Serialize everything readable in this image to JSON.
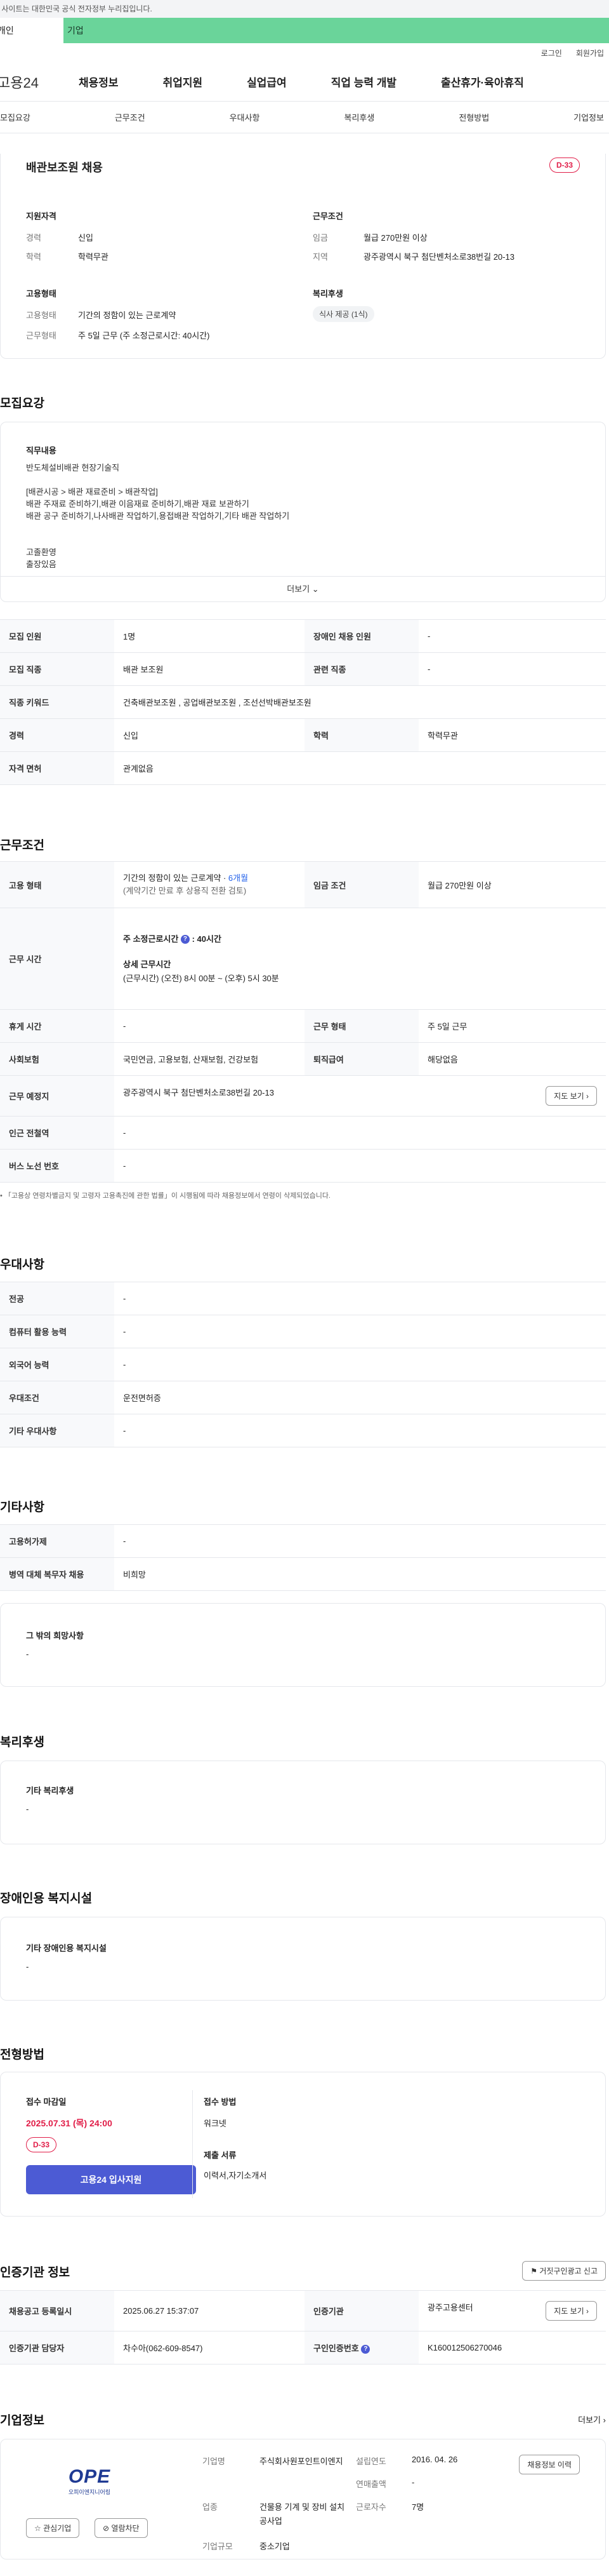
{
  "gov_banner": "이 사이트는 대한민국 공식 전자정부 누리집입니다.",
  "tabs_top": {
    "personal": "개인",
    "company": "기업"
  },
  "util": {
    "login": "로그인",
    "signup": "회원가입"
  },
  "logo": "고용24",
  "gnb": [
    "채용정보",
    "취업지원",
    "실업급여",
    "직업 능력 개발",
    "출산휴가·육아휴직"
  ],
  "sub_tabs": [
    "모집요강",
    "근무조건",
    "우대사항",
    "복리후생",
    "전형방법",
    "기업정보"
  ],
  "summary": {
    "title": "배관보조원 채용",
    "dday": "D-33",
    "qualification_title": "지원자격",
    "career_label": "경력",
    "career_value": "신입",
    "education_label": "학력",
    "education_value": "학력무관",
    "work_cond_title": "근무조건",
    "wage_label": "임금",
    "wage_value": "월급 270만원 이상",
    "region_label": "지역",
    "region_value": "광주광역시 북구 첨단벤처소로38번길 20-13",
    "employ_title": "고용형태",
    "employ_type_label": "고용형태",
    "employ_type_value": "기간의 정함이 있는 근로계약",
    "work_type_label": "근무형태",
    "work_type_value": "주 5일 근무 (주 소정근로시간: 40시간)",
    "welfare_title": "복리후생",
    "welfare_chip": "식사 제공 (1식)"
  },
  "recruit": {
    "title": "모집요강",
    "job_desc_title": "직무내용",
    "lines": [
      "반도체설비배관 현장기술직",
      "",
      "[배관시공 > 배관 재료준비 > 배관작업]",
      "배관 주재료 준비하기,배관 이음재료 준비하기,배관 재료 보관하기",
      "배관 공구 준비하기,나사배관 작업하기,용접배관 작업하기,기타 배관 작업하기",
      "",
      "",
      "고졸환영",
      "출장있음"
    ],
    "more": "더보기",
    "rows": [
      {
        "th1": "모집 인원",
        "td1": "1명",
        "th2": "장애인 채용 인원",
        "td2": "-"
      },
      {
        "th1": "모집 직종",
        "td1": "배관 보조원",
        "th2": "관련 직종",
        "td2": "-"
      },
      {
        "th1": "직종 키워드",
        "td1": "건축배관보조원 , 공업배관보조원 , 조선선박배관보조원",
        "th2": "",
        "td2": ""
      },
      {
        "th1": "경력",
        "td1": "신입",
        "th2": "학력",
        "td2": "학력무관"
      },
      {
        "th1": "자격 면허",
        "td1": "관계없음",
        "th2": "",
        "td2": ""
      }
    ]
  },
  "conditions": {
    "title": "근무조건",
    "employ_th": "고용 형태",
    "employ_td1": "기간의 정함이 있는 근로계약 · ",
    "employ_td1_highlight": "6개월",
    "employ_td2": "(계약기간 만료 후 상용직 전환 검토)",
    "wage_th": "임금 조건",
    "wage_td": "월급 270만원 이상",
    "hours_th": "근무 시간",
    "hours_weekly_label": "주 소정근로시간",
    "hours_weekly_value": ": 40시간",
    "hours_detail_label": "상세 근무시간",
    "hours_detail_value": "(근무시간) (오전) 8시 00분 ~ (오후) 5시 30분",
    "rest_th": "휴게 시간",
    "rest_td": "-",
    "worktype_th": "근무 형태",
    "worktype_td": "주 5일 근무",
    "insurance_th": "사회보험",
    "insurance_td": "국민연금, 고용보험, 산재보험, 건강보험",
    "severance_th": "퇴직급여",
    "severance_td": "해당없음",
    "location_th": "근무 예정지",
    "location_td": "광주광역시 북구 첨단벤처소로38번길 20-13",
    "map_btn": "지도 보기",
    "subway_th": "인근 전철역",
    "subway_td": "-",
    "bus_th": "버스 노선 번호",
    "bus_td": "-",
    "notice": "「고용상 연령차별금지 및 고령자 고용촉진에 관한 법률」이 시행됨에 따라 채용정보에서 연령이 삭제되었습니다."
  },
  "prefer": {
    "title": "우대사항",
    "rows": [
      {
        "th": "전공",
        "td": "-"
      },
      {
        "th": "컴퓨터 활용 능력",
        "td": "-"
      },
      {
        "th": "외국어 능력",
        "td": "-"
      },
      {
        "th": "우대조건",
        "td": "운전면허증"
      },
      {
        "th": "기타 우대사항",
        "td": "-"
      }
    ]
  },
  "etc": {
    "title": "기타사항",
    "rows": [
      {
        "th": "고용허가제",
        "td": "-"
      },
      {
        "th": "병역 대체 복무자 채용",
        "td": "비희망"
      }
    ],
    "other_title": "그 밖의 희망사항",
    "other_value": "-"
  },
  "welfare": {
    "title": "복리후생",
    "box_title": "기타 복리후생",
    "box_value": "-"
  },
  "disabled": {
    "title": "장애인용 복지시설",
    "box_title": "기타 장애인용 복지시설",
    "box_value": "-"
  },
  "screening": {
    "title": "전형방법",
    "deadline_label": "접수 마감일",
    "deadline_value": "2025.07.31 (목) 24:00",
    "dday": "D-33",
    "apply_btn": "고용24 입사지원",
    "method_label": "접수 방법",
    "method_value": "워크넷",
    "docs_label": "제출 서류",
    "docs_value": "이력서,자기소개서"
  },
  "auth": {
    "title": "인증기관 정보",
    "report_btn": "거짓구인광고 신고",
    "reg_th": "채용공고 등록일시",
    "reg_td": "2025.06.27 15:37:07",
    "agency_th": "인증기관",
    "agency_td": "광주고용센터",
    "map_btn": "지도 보기",
    "staff_th": "인증기관 담당자",
    "staff_td": "차수아(062-609-8547)",
    "job_no_th": "구인인증번호",
    "job_no_td": "K160012506270046"
  },
  "company": {
    "title": "기업정보",
    "more": "더보기",
    "logo_text": "OPE",
    "logo_sub": "오피이엔지니어링",
    "interest_btn": "관심기업",
    "block_btn": "열람차단",
    "name_label": "기업명",
    "name_value": "주식회사원포인트이엔지",
    "industry_label": "업종",
    "industry_value": "건물용 기계 및 장비 설치 공사업",
    "size_label": "기업규모",
    "size_value": "중소기업",
    "founded_label": "설립연도",
    "founded_value": "2016. 04. 26",
    "sales_label": "연매출액",
    "sales_value": "-",
    "employees_label": "근로자수",
    "employees_value": "7명",
    "history_btn": "채용정보 이력"
  },
  "colors": {
    "accent": "#4c5bd4",
    "dday": "#e11d48",
    "company_tab": "#6ad49a",
    "highlight_blue": "#2563eb"
  }
}
